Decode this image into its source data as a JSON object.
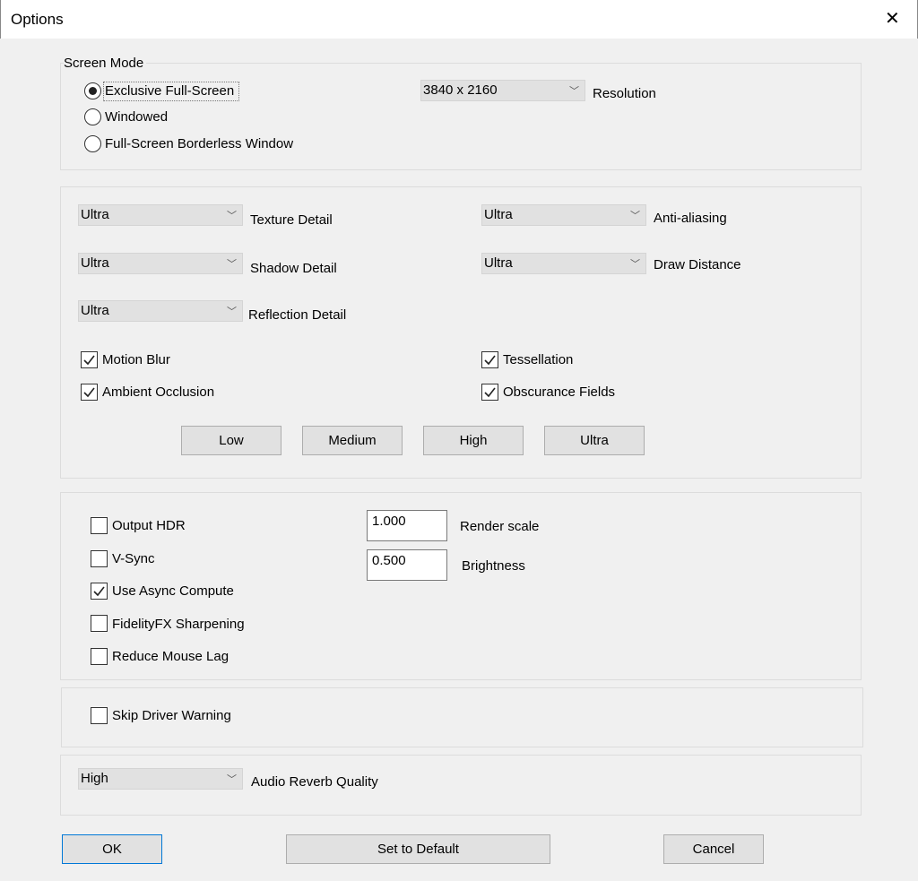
{
  "window": {
    "title": "Options",
    "close_icon": "close-icon"
  },
  "screen_mode": {
    "label": "Screen Mode",
    "options": [
      "Exclusive Full-Screen",
      "Windowed",
      "Full-Screen Borderless Window"
    ],
    "selected": 0,
    "resolution": {
      "value": "3840 x 2160",
      "label": "Resolution"
    }
  },
  "graphics": {
    "dropdowns": [
      {
        "value": "Ultra",
        "label": "Texture Detail"
      },
      {
        "value": "Ultra",
        "label": "Shadow Detail"
      },
      {
        "value": "Ultra",
        "label": "Reflection Detail"
      },
      {
        "value": "Ultra",
        "label": "Anti-aliasing"
      },
      {
        "value": "Ultra",
        "label": "Draw Distance"
      }
    ],
    "checkboxes": [
      {
        "label": "Motion Blur",
        "checked": true
      },
      {
        "label": "Ambient Occlusion",
        "checked": true
      },
      {
        "label": "Tessellation",
        "checked": true
      },
      {
        "label": "Obscurance Fields",
        "checked": true
      }
    ],
    "presets": [
      "Low",
      "Medium",
      "High",
      "Ultra"
    ]
  },
  "display": {
    "checkboxes": [
      {
        "label": "Output HDR",
        "checked": false
      },
      {
        "label": "V-Sync",
        "checked": false
      },
      {
        "label": "Use Async Compute",
        "checked": true
      },
      {
        "label": "FidelityFX Sharpening",
        "checked": false
      },
      {
        "label": "Reduce Mouse Lag",
        "checked": false
      }
    ],
    "render_scale": {
      "value": "1.000",
      "label": "Render scale"
    },
    "brightness": {
      "value": "0.500",
      "label": "Brightness"
    }
  },
  "driver": {
    "label": "Skip Driver Warning",
    "checked": false
  },
  "audio": {
    "value": "High",
    "label": "Audio Reverb Quality"
  },
  "buttons": {
    "ok": "OK",
    "default": "Set to Default",
    "cancel": "Cancel"
  }
}
